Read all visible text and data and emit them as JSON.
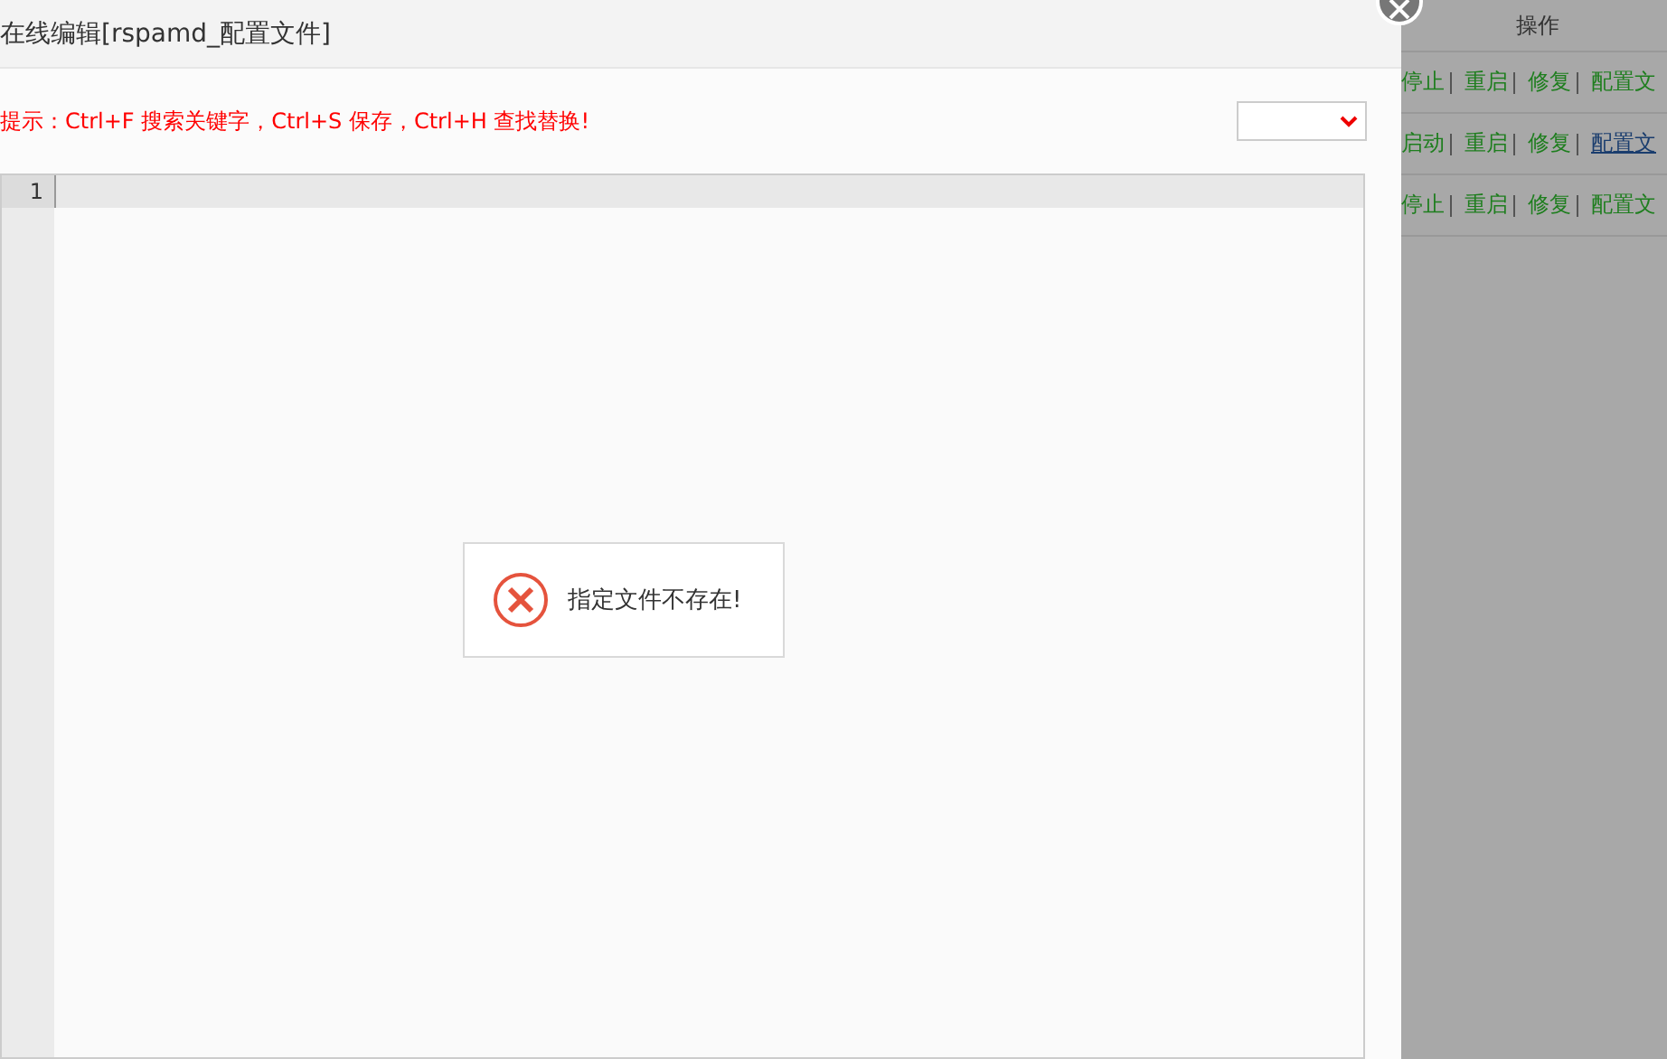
{
  "dialog": {
    "title": "在线编辑[rspamd_配置文件]",
    "hint": "提示：Ctrl+F 搜索关键字，Ctrl+S 保存，Ctrl+H 查找替换!",
    "editor": {
      "line_numbers": [
        "1"
      ]
    },
    "toast": {
      "message": "指定文件不存在!"
    }
  },
  "background_table": {
    "column_header": "操作",
    "rows": [
      {
        "actions": [
          {
            "label": "停止",
            "link": false
          },
          {
            "label": "重启",
            "link": false
          },
          {
            "label": "修复",
            "link": false
          },
          {
            "label": "配置文",
            "link": false
          }
        ]
      },
      {
        "actions": [
          {
            "label": "启动",
            "link": false
          },
          {
            "label": "重启",
            "link": false
          },
          {
            "label": "修复",
            "link": false
          },
          {
            "label": "配置文",
            "link": true
          }
        ]
      },
      {
        "actions": [
          {
            "label": "停止",
            "link": false
          },
          {
            "label": "重启",
            "link": false
          },
          {
            "label": "修复",
            "link": false
          },
          {
            "label": "配置文",
            "link": false
          }
        ]
      }
    ]
  }
}
